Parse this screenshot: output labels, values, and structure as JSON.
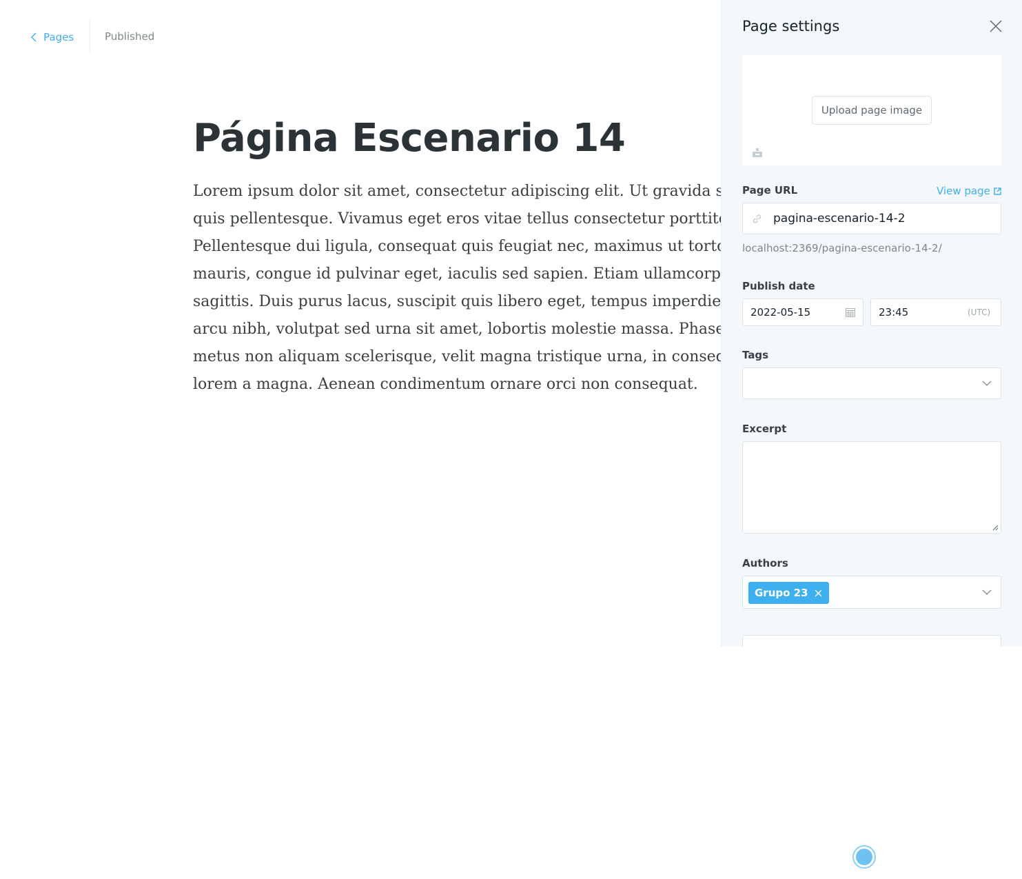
{
  "header": {
    "back_label": "Pages",
    "status": "Published"
  },
  "editor": {
    "title": "Página Escenario 14",
    "body_lines": [
      "Lorem ipsum dolor sit amet, consectetur adipiscing elit. Ut gravida sc",
      "quis pellentesque. Vivamus eget eros vitae tellus consectetur porttitor",
      "Pellentesque dui ligula, consequat quis feugiat nec, maximus ut torto",
      "mauris, congue id pulvinar eget, iaculis sed sapien. Etiam ullamcorpe",
      "sagittis. Duis purus lacus, suscipit quis libero eget, tempus imperdiet",
      "arcu nibh, volutpat sed urna sit amet, lobortis molestie massa. Phasel",
      "metus non aliquam scelerisque, velit magna tristique urna, in conseq",
      "lorem a magna. Aenean condimentum ornare orci non consequat."
    ]
  },
  "settings": {
    "title": "Page settings",
    "upload_label": "Upload page image",
    "page_url_label": "Page URL",
    "view_page_label": "View page",
    "slug": "pagina-escenario-14-2",
    "url_hint": "localhost:2369/pagina-escenario-14-2/",
    "publish_date_label": "Publish date",
    "date": "2022-05-15",
    "time": "23:45",
    "timezone": "(UTC)",
    "tags_label": "Tags",
    "excerpt_label": "Excerpt",
    "authors_label": "Authors",
    "author_chip": "Grupo 23"
  },
  "colors": {
    "accent": "#3eb0ef",
    "panel_bg": "#f4f8fb",
    "spellcheck": "#e02020"
  },
  "icons": [
    "chevron-left-icon",
    "close-icon",
    "image-placeholder-icon",
    "link-icon",
    "external-link-icon",
    "calendar-icon",
    "chevron-down-icon",
    "remove-icon",
    "resize-grip-icon"
  ]
}
